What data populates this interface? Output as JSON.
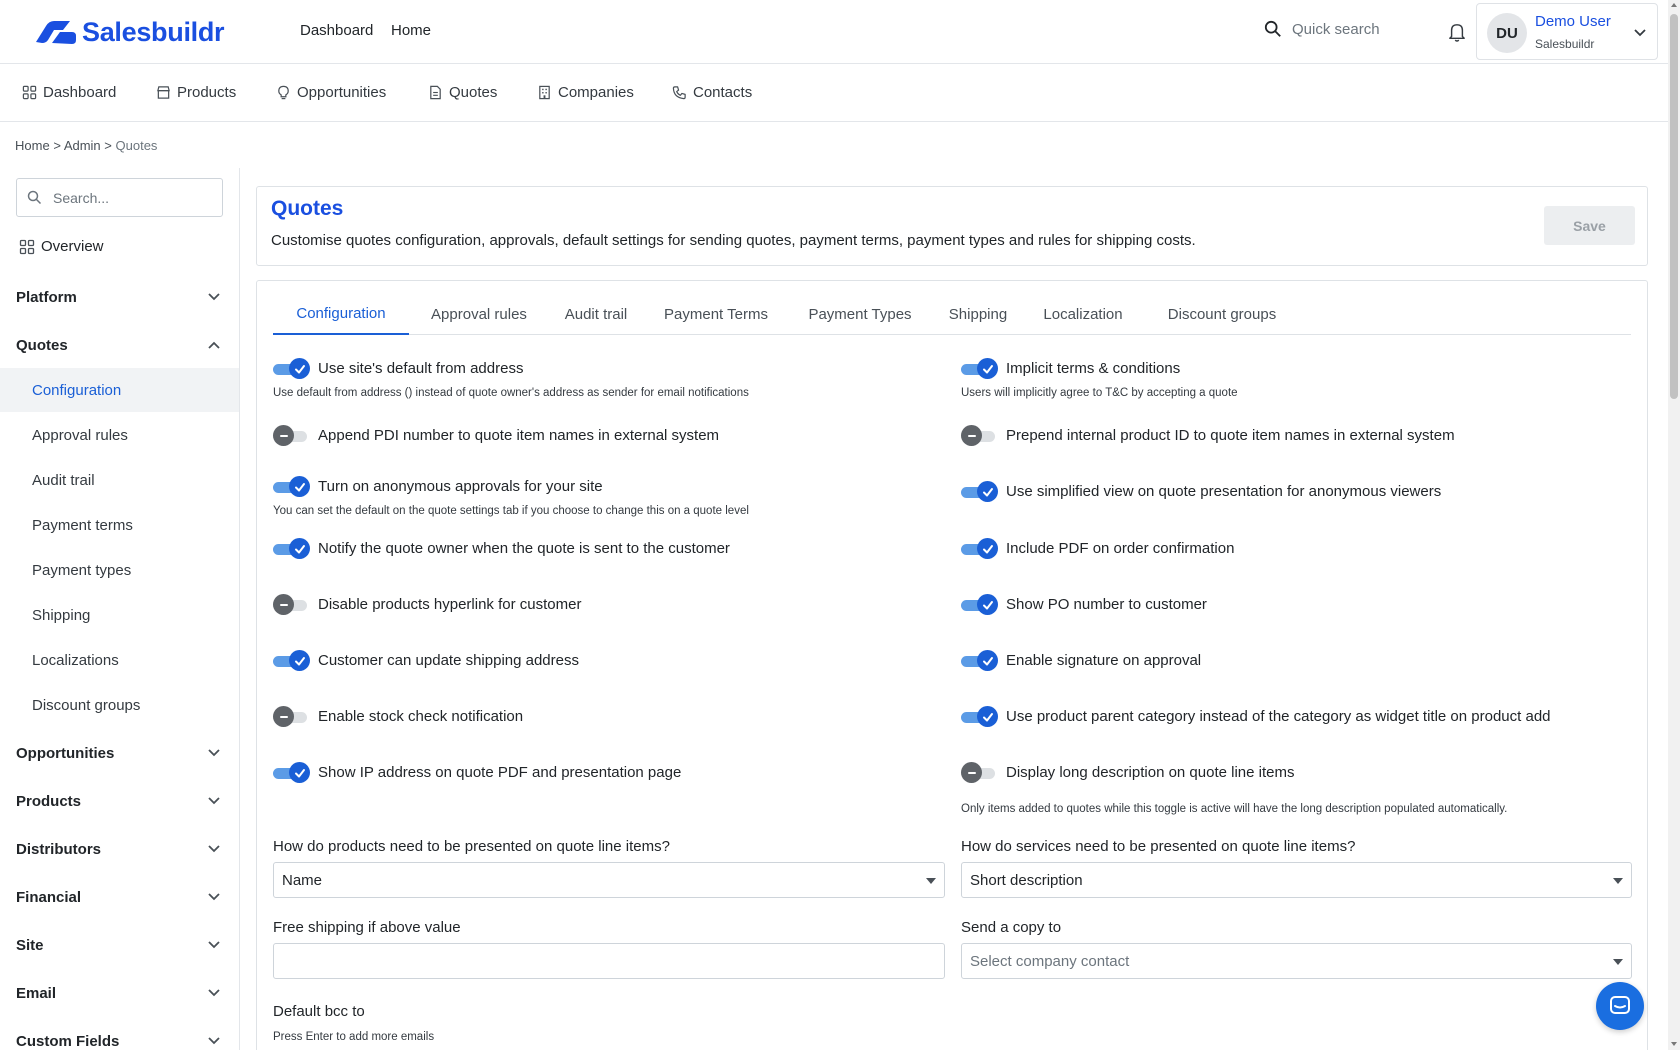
{
  "app": {
    "brand": "Salesbuildr",
    "top_links": [
      "Dashboard",
      "Home"
    ],
    "quick_search": "Quick search",
    "user": {
      "initials": "DU",
      "name": "Demo User",
      "org": "Salesbuildr"
    }
  },
  "module_nav": [
    "Dashboard",
    "Products",
    "Opportunities",
    "Quotes",
    "Companies",
    "Contacts"
  ],
  "breadcrumb": {
    "home": "Home",
    "admin": "Admin",
    "current": "Quotes",
    "sep": ">"
  },
  "sidebar": {
    "search_placeholder": "Search...",
    "overview": "Overview",
    "groups": {
      "platform": "Platform",
      "quotes": "Quotes",
      "opportunities": "Opportunities",
      "products": "Products",
      "distributors": "Distributors",
      "financial": "Financial",
      "site": "Site",
      "email": "Email",
      "custom_fields": "Custom Fields"
    },
    "quotes_items": [
      "Configuration",
      "Approval rules",
      "Audit trail",
      "Payment terms",
      "Payment types",
      "Shipping",
      "Localizations",
      "Discount groups"
    ]
  },
  "page": {
    "title": "Quotes",
    "description": "Customise quotes configuration, approvals, default settings for sending quotes, payment terms, payment types and rules for shipping costs.",
    "save": "Save"
  },
  "tabs": [
    "Configuration",
    "Approval rules",
    "Audit trail",
    "Payment Terms",
    "Payment Types",
    "Shipping",
    "Localization",
    "Discount groups"
  ],
  "options_left": [
    {
      "label": "Use site's default from address",
      "on": true,
      "hint": "Use default from address () instead of quote owner's address as sender for email notifications"
    },
    {
      "label": "Append PDI number to quote item names in external system",
      "on": false,
      "hint": ""
    },
    {
      "label": "Turn on anonymous approvals for your site",
      "on": true,
      "hint": "You can set the default on the quote settings tab if you choose to change this on a quote level"
    },
    {
      "label": "Notify the quote owner when the quote is sent to the customer",
      "on": true,
      "hint": ""
    },
    {
      "label": "Disable products hyperlink for customer",
      "on": false,
      "hint": ""
    },
    {
      "label": "Customer can update shipping address",
      "on": true,
      "hint": ""
    },
    {
      "label": "Enable stock check notification",
      "on": false,
      "hint": ""
    },
    {
      "label": "Show IP address on quote PDF and presentation page",
      "on": true,
      "hint": ""
    }
  ],
  "options_right": [
    {
      "label": "Implicit terms & conditions",
      "on": true,
      "hint": "Users will implicitly agree to T&C by accepting a quote"
    },
    {
      "label": "Prepend internal product ID to quote item names in external system",
      "on": false,
      "hint": ""
    },
    {
      "label": "Use simplified view on quote presentation for anonymous viewers",
      "on": true,
      "hint": ""
    },
    {
      "label": "Include PDF on order confirmation",
      "on": true,
      "hint": ""
    },
    {
      "label": "Show PO number to customer",
      "on": true,
      "hint": ""
    },
    {
      "label": "Enable signature on approval",
      "on": true,
      "hint": ""
    },
    {
      "label": "Use product parent category instead of the category as widget title on product add",
      "on": true,
      "hint": ""
    },
    {
      "label": "Display long description on quote line items",
      "on": false,
      "hint": "Only items added to quotes while this toggle is active will have the long description populated automatically."
    }
  ],
  "fields": {
    "products_presentation_label": "How do products need to be presented on quote line items?",
    "products_presentation_value": "Name",
    "services_presentation_label": "How do services need to be presented on quote line items?",
    "services_presentation_value": "Short description",
    "free_shipping_label": "Free shipping if above value",
    "free_shipping_value": "",
    "send_copy_label": "Send a copy to",
    "send_copy_placeholder": "Select company contact",
    "bcc_label": "Default bcc to",
    "bcc_hint": "Press Enter to add more emails"
  },
  "colors": {
    "brand": "#1a4fe0",
    "accent": "#1a5fd6",
    "toggle_on": "#1a5fd6",
    "toggle_off": "#5f6368"
  },
  "icons": {
    "search": "search-icon",
    "bell": "bell-icon",
    "chevron": "chevron-down-icon",
    "dashboard": "grid-icon",
    "products": "store-icon",
    "opportunities": "lightbulb-icon",
    "quotes": "document-icon",
    "companies": "building-icon",
    "contacts": "phone-icon",
    "chat": "chat-icon"
  }
}
